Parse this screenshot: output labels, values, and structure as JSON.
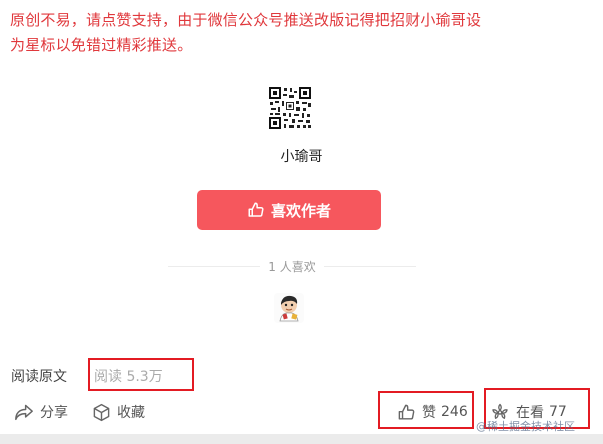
{
  "notice": {
    "line1": "原创不易，请点赞支持，由于微信公众号推送改版记得把招财小瑜哥设",
    "line2": "为星标以免错过精彩推送。"
  },
  "author": {
    "name": "小瑜哥",
    "like_button_label": "喜欢作者",
    "likers_text": "1 人喜欢"
  },
  "footer": {
    "read_original": "阅读原文",
    "read_count": "阅读 5.3万",
    "share_label": "分享",
    "favorite_label": "收藏",
    "like_label": "赞",
    "like_count": "246",
    "watching_label": "在看",
    "watching_count": "77"
  },
  "watermark": "@稀土掘金技术社区",
  "colors": {
    "notice_red": "#e0383c",
    "button_red": "#f6575d",
    "annotation_red": "#e31b23"
  },
  "icons": {
    "qr": "qr-code-icon",
    "like_button": "thumbs-up-icon",
    "share": "share-arrow-icon",
    "favorite": "cube-icon",
    "like": "thumbs-up-icon",
    "watching": "flower-icon"
  }
}
